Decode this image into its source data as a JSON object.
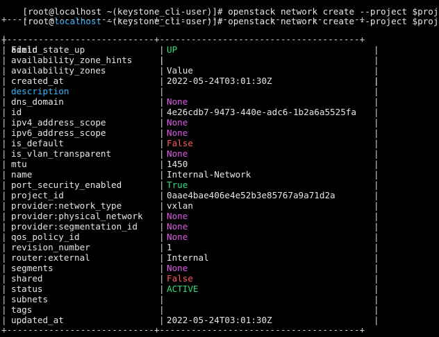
{
  "top_line": {
    "text": "[root@localhost ~(keystone_cli-user)]# openstack network create --project $proj",
    "prompt_user": "root",
    "prompt_host": "localhost",
    "prompt_dir": "~(keystone_cli-user)",
    "command": "openstack network create --project $proj"
  },
  "header": {
    "field": "Field",
    "value": "Value"
  },
  "border_dash": "+----------------------------+--------------------------------------+",
  "rows": [
    {
      "field": "admin_state_up",
      "value": "UP",
      "value_color": "green"
    },
    {
      "field": "availability_zone_hints",
      "value": "",
      "value_color": "white"
    },
    {
      "field": "availability_zones",
      "value": "",
      "value_color": "white"
    },
    {
      "field": "created_at",
      "value": "2022-05-24T03:01:30Z",
      "value_color": "white"
    },
    {
      "field": "description",
      "value": "",
      "value_color": "white",
      "field_color": "cyan"
    },
    {
      "field": "dns_domain",
      "value": "None",
      "value_color": "magenta"
    },
    {
      "field": "id",
      "value": "4e26cdb7-9473-440e-adc6-1b2a6a5525fa",
      "value_color": "white"
    },
    {
      "field": "ipv4_address_scope",
      "value": "None",
      "value_color": "magenta"
    },
    {
      "field": "ipv6_address_scope",
      "value": "None",
      "value_color": "magenta"
    },
    {
      "field": "is_default",
      "value": "False",
      "value_color": "red"
    },
    {
      "field": "is_vlan_transparent",
      "value": "None",
      "value_color": "magenta"
    },
    {
      "field": "mtu",
      "value": "1450",
      "value_color": "white"
    },
    {
      "field": "name",
      "value": "Internal-Network",
      "value_color": "white"
    },
    {
      "field": "port_security_enabled",
      "value": "True",
      "value_color": "green"
    },
    {
      "field": "project_id",
      "value": "0aae4bae406e4e52b3e85767a9a71d2a",
      "value_color": "white"
    },
    {
      "field": "provider:network_type",
      "value": "vxlan",
      "value_color": "white"
    },
    {
      "field": "provider:physical_network",
      "value": "None",
      "value_color": "magenta"
    },
    {
      "field": "provider:segmentation_id",
      "value": "None",
      "value_color": "magenta"
    },
    {
      "field": "qos_policy_id",
      "value": "None",
      "value_color": "magenta"
    },
    {
      "field": "revision_number",
      "value": "1",
      "value_color": "white"
    },
    {
      "field": "router:external",
      "value": "Internal",
      "value_color": "white"
    },
    {
      "field": "segments",
      "value": "None",
      "value_color": "magenta"
    },
    {
      "field": "shared",
      "value": "False",
      "value_color": "red"
    },
    {
      "field": "status",
      "value": "ACTIVE",
      "value_color": "green"
    },
    {
      "field": "subnets",
      "value": "",
      "value_color": "white"
    },
    {
      "field": "tags",
      "value": "",
      "value_color": "white"
    },
    {
      "field": "updated_at",
      "value": "2022-05-24T03:01:30Z",
      "value_color": "white"
    }
  ],
  "colors": {
    "background": "#000000",
    "text": "#e6e6e6",
    "green": "#2ee07a",
    "magenta": "#e05be8",
    "red": "#ff5a5a",
    "cyan": "#35b6ff"
  }
}
